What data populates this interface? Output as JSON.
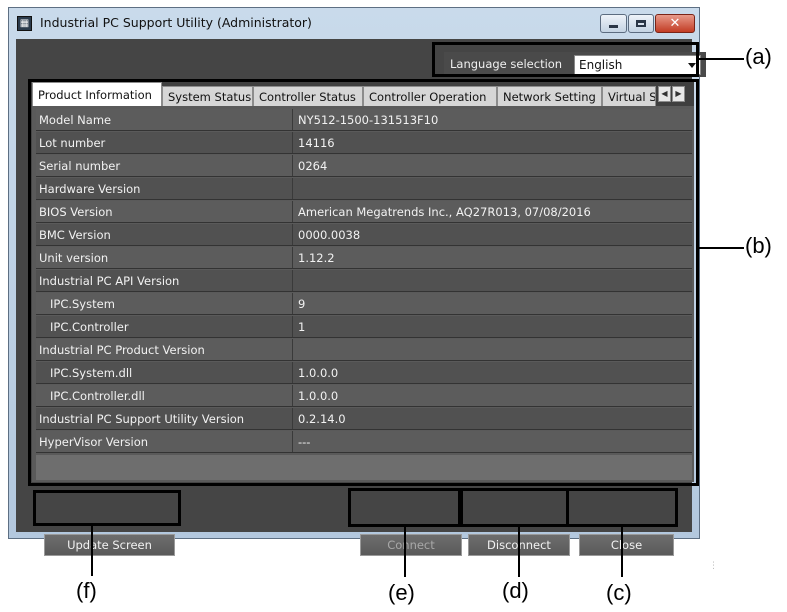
{
  "window": {
    "title": "Industrial PC Support Utility (Administrator)",
    "app_icon": "terminal-icon",
    "controls": {
      "minimize": "minimize-icon",
      "maximize": "maximize-icon",
      "close": "close-icon"
    }
  },
  "language": {
    "label": "Language selection",
    "value": "English"
  },
  "tabs": [
    {
      "label": "Product Information"
    },
    {
      "label": "System Status"
    },
    {
      "label": "Controller Status"
    },
    {
      "label": "Controller Operation"
    },
    {
      "label": "Network Setting"
    },
    {
      "label": "Virtual S"
    }
  ],
  "rows": [
    {
      "name": "Model Name",
      "value": "NY512-1500-131513F10"
    },
    {
      "name": "Lot number",
      "value": "14116"
    },
    {
      "name": "Serial number",
      "value": "0264"
    },
    {
      "name": "Hardware Version",
      "value": ""
    },
    {
      "name": "BIOS Version",
      "value": "American Megatrends Inc., AQ27R013, 07/08/2016"
    },
    {
      "name": "BMC Version",
      "value": "0000.0038"
    },
    {
      "name": "Unit version",
      "value": "1.12.2"
    },
    {
      "name": "Industrial PC API Version",
      "value": ""
    },
    {
      "name": "IPC.System",
      "value": "9"
    },
    {
      "name": "IPC.Controller",
      "value": "1"
    },
    {
      "name": "Industrial PC Product Version",
      "value": ""
    },
    {
      "name": "IPC.System.dll",
      "value": "1.0.0.0"
    },
    {
      "name": "IPC.Controller.dll",
      "value": "1.0.0.0"
    },
    {
      "name": "Industrial PC Support Utility Version",
      "value": "0.2.14.0"
    },
    {
      "name": "HyperVisor Version",
      "value": "---"
    }
  ],
  "buttons": {
    "update": "Update Screen",
    "connect": "Connect",
    "disconnect": "Disconnect",
    "close": "Close"
  },
  "callouts": {
    "a": "(a)",
    "b": "(b)",
    "c": "(c)",
    "d": "(d)",
    "e": "(e)",
    "f": "(f)"
  }
}
